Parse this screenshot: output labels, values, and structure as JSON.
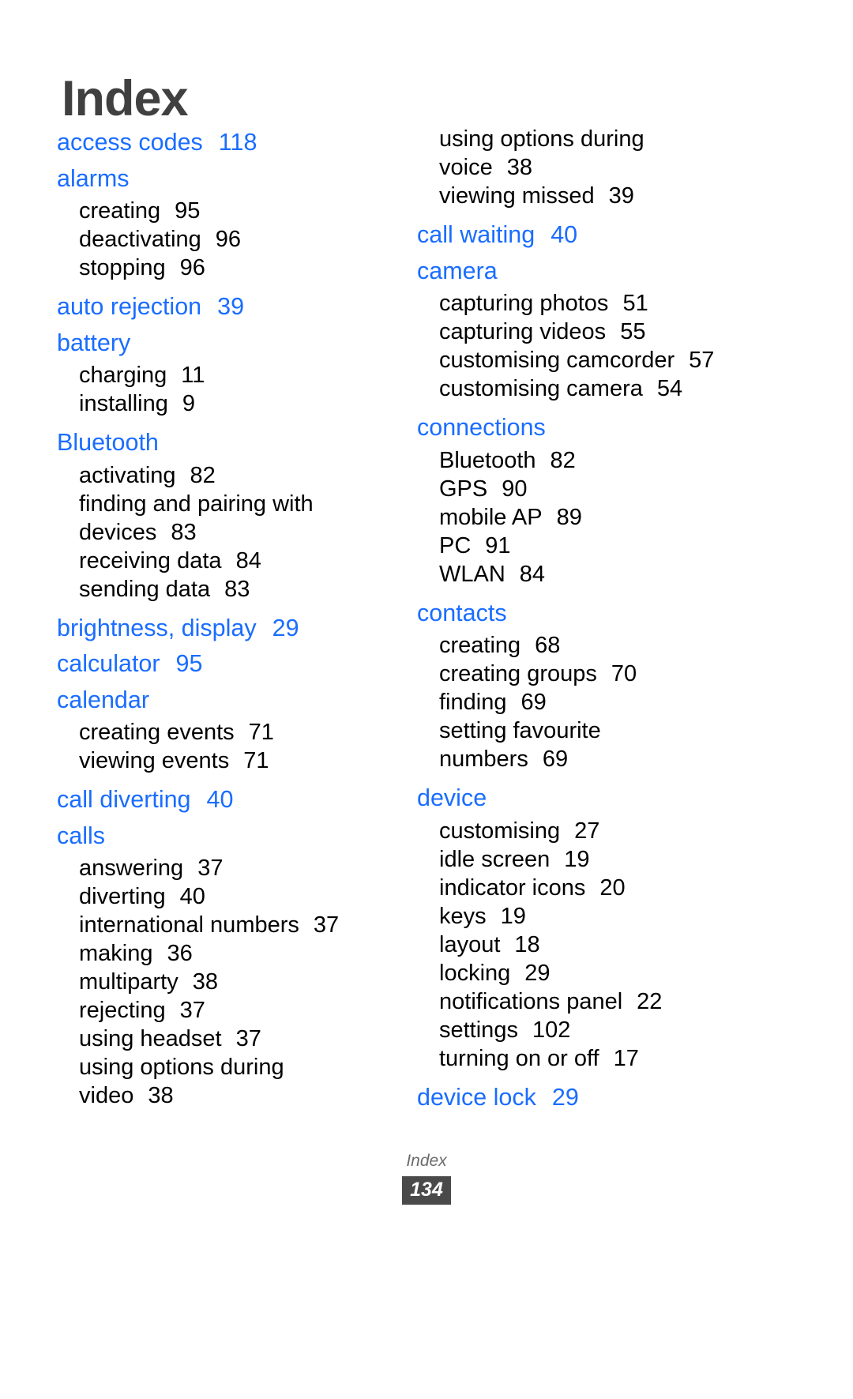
{
  "document": {
    "title": "Index",
    "accent_color": "#1a6dff",
    "title_color": "#404040"
  },
  "footer": {
    "label": "Index",
    "page_number": "134"
  },
  "columns": [
    {
      "name": "left-column",
      "entries": [
        {
          "type": "head",
          "label": "access codes",
          "page": "118"
        },
        {
          "type": "head",
          "label": "alarms",
          "page": ""
        },
        {
          "type": "sub",
          "label": "creating",
          "page": "95"
        },
        {
          "type": "sub",
          "label": "deactivating",
          "page": "96"
        },
        {
          "type": "sub",
          "label": "stopping",
          "page": "96"
        },
        {
          "type": "head",
          "label": "auto rejection",
          "page": "39"
        },
        {
          "type": "head",
          "label": "battery",
          "page": ""
        },
        {
          "type": "sub",
          "label": "charging",
          "page": "11"
        },
        {
          "type": "sub",
          "label": "installing",
          "page": "9"
        },
        {
          "type": "head",
          "label": "Bluetooth",
          "page": ""
        },
        {
          "type": "sub",
          "label": "activating",
          "page": "82"
        },
        {
          "type": "sub",
          "label": "finding and pairing with",
          "page": ""
        },
        {
          "type": "sub",
          "label": "devices",
          "page": "83"
        },
        {
          "type": "sub",
          "label": "receiving data",
          "page": "84"
        },
        {
          "type": "sub",
          "label": "sending data",
          "page": "83"
        },
        {
          "type": "head",
          "label": "brightness, display",
          "page": "29"
        },
        {
          "type": "head",
          "label": "calculator",
          "page": "95"
        },
        {
          "type": "head",
          "label": "calendar",
          "page": ""
        },
        {
          "type": "sub",
          "label": "creating events",
          "page": "71"
        },
        {
          "type": "sub",
          "label": "viewing events",
          "page": "71"
        },
        {
          "type": "head",
          "label": "call diverting",
          "page": "40"
        },
        {
          "type": "head",
          "label": "calls",
          "page": ""
        },
        {
          "type": "sub",
          "label": "answering",
          "page": "37"
        },
        {
          "type": "sub",
          "label": "diverting",
          "page": "40"
        },
        {
          "type": "sub",
          "label": "international numbers",
          "page": "37"
        },
        {
          "type": "sub",
          "label": "making",
          "page": "36"
        },
        {
          "type": "sub",
          "label": "multiparty",
          "page": "38"
        },
        {
          "type": "sub",
          "label": "rejecting",
          "page": "37"
        },
        {
          "type": "sub",
          "label": "using headset",
          "page": "37"
        },
        {
          "type": "sub",
          "label": "using options during",
          "page": ""
        },
        {
          "type": "sub",
          "label": "video",
          "page": "38"
        }
      ]
    },
    {
      "name": "right-column",
      "entries": [
        {
          "type": "sub",
          "label": "using options during",
          "page": ""
        },
        {
          "type": "sub",
          "label": "voice",
          "page": "38"
        },
        {
          "type": "sub",
          "label": "viewing missed",
          "page": "39"
        },
        {
          "type": "head",
          "label": "call waiting",
          "page": "40"
        },
        {
          "type": "head",
          "label": "camera",
          "page": ""
        },
        {
          "type": "sub",
          "label": "capturing photos",
          "page": "51"
        },
        {
          "type": "sub",
          "label": "capturing videos",
          "page": "55"
        },
        {
          "type": "sub",
          "label": "customising camcorder",
          "page": "57"
        },
        {
          "type": "sub",
          "label": "customising camera",
          "page": "54"
        },
        {
          "type": "head",
          "label": "connections",
          "page": ""
        },
        {
          "type": "sub",
          "label": "Bluetooth",
          "page": "82"
        },
        {
          "type": "sub",
          "label": "GPS",
          "page": "90"
        },
        {
          "type": "sub",
          "label": "mobile AP",
          "page": "89"
        },
        {
          "type": "sub",
          "label": "PC",
          "page": "91"
        },
        {
          "type": "sub",
          "label": "WLAN",
          "page": "84"
        },
        {
          "type": "head",
          "label": "contacts",
          "page": ""
        },
        {
          "type": "sub",
          "label": "creating",
          "page": "68"
        },
        {
          "type": "sub",
          "label": "creating groups",
          "page": "70"
        },
        {
          "type": "sub",
          "label": "finding",
          "page": "69"
        },
        {
          "type": "sub",
          "label": "setting favourite",
          "page": ""
        },
        {
          "type": "sub",
          "label": "numbers",
          "page": "69"
        },
        {
          "type": "head",
          "label": "device",
          "page": ""
        },
        {
          "type": "sub",
          "label": "customising",
          "page": "27"
        },
        {
          "type": "sub",
          "label": "idle screen",
          "page": "19"
        },
        {
          "type": "sub",
          "label": "indicator icons",
          "page": "20"
        },
        {
          "type": "sub",
          "label": "keys",
          "page": "19"
        },
        {
          "type": "sub",
          "label": "layout",
          "page": "18"
        },
        {
          "type": "sub",
          "label": "locking",
          "page": "29"
        },
        {
          "type": "sub",
          "label": "notifications panel",
          "page": "22"
        },
        {
          "type": "sub",
          "label": "settings",
          "page": "102"
        },
        {
          "type": "sub",
          "label": "turning on or off",
          "page": "17"
        },
        {
          "type": "head",
          "label": "device lock",
          "page": "29"
        }
      ]
    }
  ]
}
